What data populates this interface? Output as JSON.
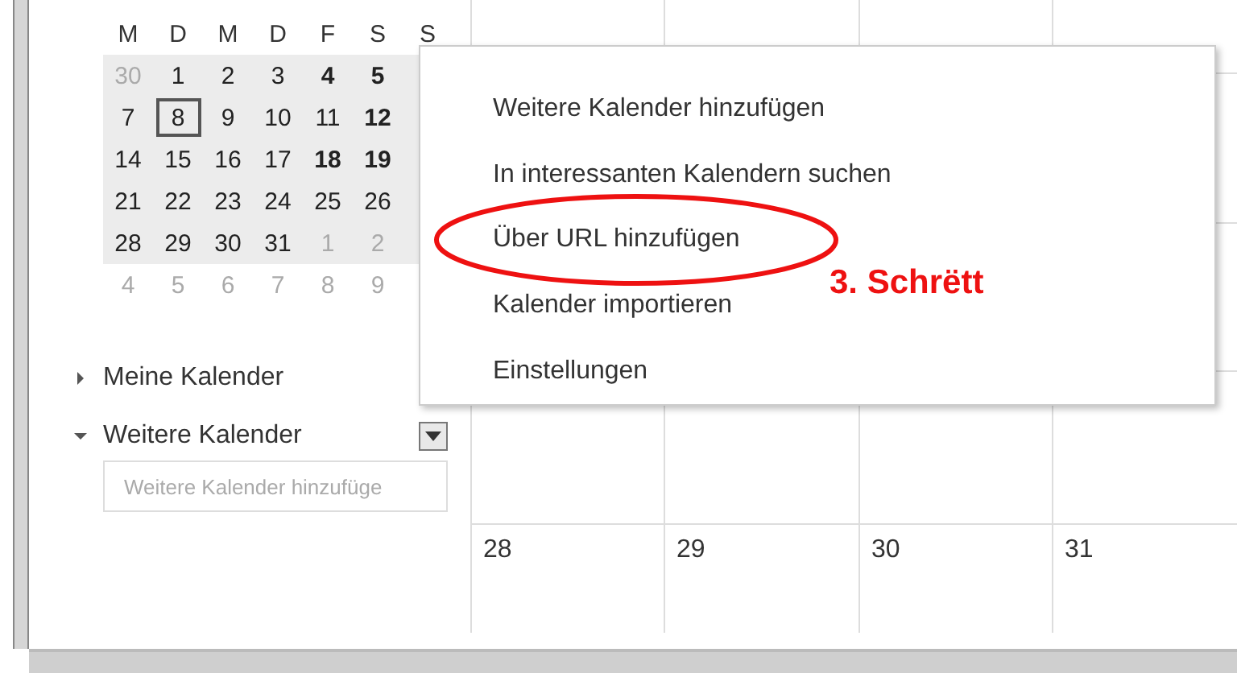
{
  "mini_calendar": {
    "weekdays": [
      "M",
      "D",
      "M",
      "D",
      "F",
      "S",
      "S"
    ],
    "weeks": [
      [
        {
          "day": "30",
          "muted": true,
          "bold": false,
          "selected": false
        },
        {
          "day": "1",
          "muted": false,
          "bold": false,
          "selected": false
        },
        {
          "day": "2",
          "muted": false,
          "bold": false,
          "selected": false
        },
        {
          "day": "3",
          "muted": false,
          "bold": false,
          "selected": false
        },
        {
          "day": "4",
          "muted": false,
          "bold": true,
          "selected": false
        },
        {
          "day": "5",
          "muted": false,
          "bold": true,
          "selected": false
        }
      ],
      [
        {
          "day": "7",
          "muted": false,
          "bold": false,
          "selected": false
        },
        {
          "day": "8",
          "muted": false,
          "bold": false,
          "selected": true
        },
        {
          "day": "9",
          "muted": false,
          "bold": false,
          "selected": false
        },
        {
          "day": "10",
          "muted": false,
          "bold": false,
          "selected": false
        },
        {
          "day": "11",
          "muted": false,
          "bold": false,
          "selected": false
        },
        {
          "day": "12",
          "muted": false,
          "bold": true,
          "selected": false
        }
      ],
      [
        {
          "day": "14",
          "muted": false,
          "bold": false,
          "selected": false
        },
        {
          "day": "15",
          "muted": false,
          "bold": false,
          "selected": false
        },
        {
          "day": "16",
          "muted": false,
          "bold": false,
          "selected": false
        },
        {
          "day": "17",
          "muted": false,
          "bold": false,
          "selected": false
        },
        {
          "day": "18",
          "muted": false,
          "bold": true,
          "selected": false
        },
        {
          "day": "19",
          "muted": false,
          "bold": true,
          "selected": false
        }
      ],
      [
        {
          "day": "21",
          "muted": false,
          "bold": false,
          "selected": false
        },
        {
          "day": "22",
          "muted": false,
          "bold": false,
          "selected": false
        },
        {
          "day": "23",
          "muted": false,
          "bold": false,
          "selected": false
        },
        {
          "day": "24",
          "muted": false,
          "bold": false,
          "selected": false
        },
        {
          "day": "25",
          "muted": false,
          "bold": false,
          "selected": false
        },
        {
          "day": "26",
          "muted": false,
          "bold": false,
          "selected": false
        }
      ],
      [
        {
          "day": "28",
          "muted": false,
          "bold": false,
          "selected": false
        },
        {
          "day": "29",
          "muted": false,
          "bold": false,
          "selected": false
        },
        {
          "day": "30",
          "muted": false,
          "bold": false,
          "selected": false
        },
        {
          "day": "31",
          "muted": false,
          "bold": false,
          "selected": false
        },
        {
          "day": "1",
          "muted": true,
          "bold": false,
          "selected": false
        },
        {
          "day": "2",
          "muted": true,
          "bold": false,
          "selected": false
        }
      ],
      [
        {
          "day": "4",
          "muted": true,
          "bold": false,
          "selected": false
        },
        {
          "day": "5",
          "muted": true,
          "bold": false,
          "selected": false
        },
        {
          "day": "6",
          "muted": true,
          "bold": false,
          "selected": false
        },
        {
          "day": "7",
          "muted": true,
          "bold": false,
          "selected": false
        },
        {
          "day": "8",
          "muted": true,
          "bold": false,
          "selected": false
        },
        {
          "day": "9",
          "muted": true,
          "bold": false,
          "selected": false
        }
      ]
    ]
  },
  "sections": [
    {
      "label": "Meine Kalender",
      "expanded": false
    },
    {
      "label": "Weitere Kalender",
      "expanded": true
    }
  ],
  "add_field": {
    "placeholder": "Weitere Kalender hinzufüge"
  },
  "month_grid": {
    "day_numbers": [
      "28",
      "29",
      "30",
      "31"
    ]
  },
  "menu": {
    "items": [
      {
        "label": "Weitere Kalender hinzufügen",
        "circled": false
      },
      {
        "label": "In interessanten Kalendern suchen",
        "circled": false
      },
      {
        "label": "Über URL hinzufügen",
        "circled": true
      },
      {
        "label": "Kalender importieren",
        "circled": false
      },
      {
        "label": "Einstellungen",
        "circled": false
      }
    ]
  },
  "annotation": {
    "text": "3. Schrëtt"
  }
}
